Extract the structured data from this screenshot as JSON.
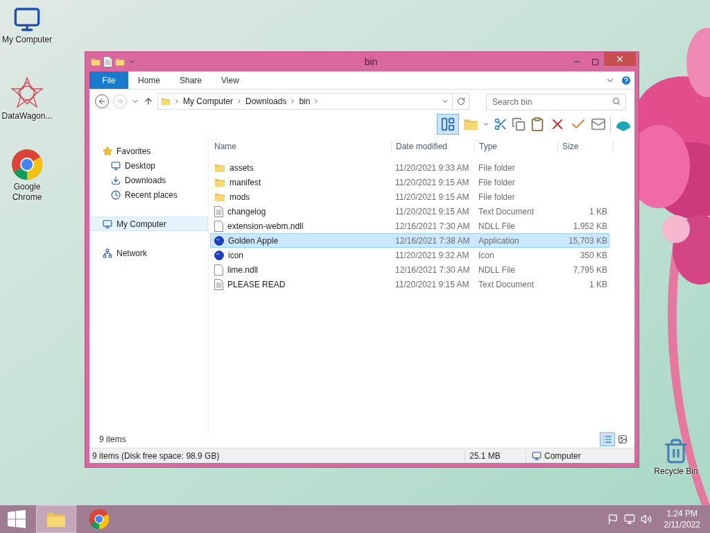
{
  "desktop_icons": [
    {
      "label": "My Computer"
    },
    {
      "label": "DataWagon..."
    },
    {
      "label": "Google Chrome"
    },
    {
      "label": "Recycle Bin"
    }
  ],
  "window": {
    "title": "bin",
    "ribbon_tabs": [
      {
        "label": "File",
        "kind": "file"
      },
      {
        "label": "Home",
        "kind": "tab"
      },
      {
        "label": "Share",
        "kind": "tab"
      },
      {
        "label": "View",
        "kind": "tab"
      }
    ],
    "breadcrumbs": [
      "My Computer",
      "Downloads",
      "bin"
    ],
    "search": {
      "placeholder": "Search bin"
    },
    "preview_pane_selected": true,
    "sidebar": [
      {
        "label": "Favorites",
        "selected": false,
        "children": [
          {
            "label": "Desktop",
            "selected": false
          },
          {
            "label": "Downloads",
            "selected": false
          },
          {
            "label": "Recent places",
            "selected": false
          }
        ]
      },
      {
        "label": "My Computer",
        "selected": true
      },
      {
        "label": "Network",
        "selected": false
      }
    ],
    "columns": [
      "Name",
      "Date modified",
      "Type",
      "Size"
    ],
    "rows": [
      {
        "kind": "folder",
        "name": "assets",
        "date": "11/20/2021 9:33 AM",
        "type": "File folder",
        "size": "",
        "selected": false
      },
      {
        "kind": "folder",
        "name": "manifest",
        "date": "11/20/2021 9:15 AM",
        "type": "File folder",
        "selected": false
      },
      {
        "kind": "folder",
        "name": "mods",
        "date": "11/20/2021 9:15 AM",
        "type": "File folder",
        "selected": false
      },
      {
        "kind": "text",
        "name": "changelog",
        "date": "11/20/2021 9:15 AM",
        "type": "Text Document",
        "size": "1 KB",
        "selected": false
      },
      {
        "kind": "file",
        "name": "extension-webm.ndll",
        "date": "12/16/2021 7:30 AM",
        "type": "NDLL File",
        "size": "1,952 KB",
        "selected": false
      },
      {
        "kind": "app",
        "name": "Golden Apple",
        "date": "12/16/2021 7:38 AM",
        "type": "Application",
        "size": "15,703 KB",
        "selected": true
      },
      {
        "kind": "app",
        "name": "icon",
        "date": "11/20/2021 9:32 AM",
        "type": "Icon",
        "size": "350 KB",
        "selected": false
      },
      {
        "kind": "file",
        "name": "lime.ndll",
        "date": "12/16/2021 7:30 AM",
        "type": "NDLL File",
        "size": "7,795 KB",
        "selected": false
      },
      {
        "kind": "text",
        "name": "PLEASE READ",
        "date": "11/20/2021 9:15 AM",
        "type": "Text Document",
        "size": "1 KB",
        "selected": false
      }
    ],
    "item_count": "9 items",
    "views": [
      {
        "kind": "details",
        "selected": true
      },
      {
        "kind": "large_icons",
        "selected": false
      }
    ],
    "status_bar": {
      "summary": "9 items (Disk free space: 98.9 GB)",
      "size": "25.1 MB",
      "location": "Computer"
    }
  },
  "taskbar": {
    "apps": [
      {
        "kind": "explorer",
        "selected": true
      },
      {
        "kind": "chrome",
        "selected": false
      }
    ],
    "time": "1:24 PM",
    "date": "2/11/2022"
  }
}
